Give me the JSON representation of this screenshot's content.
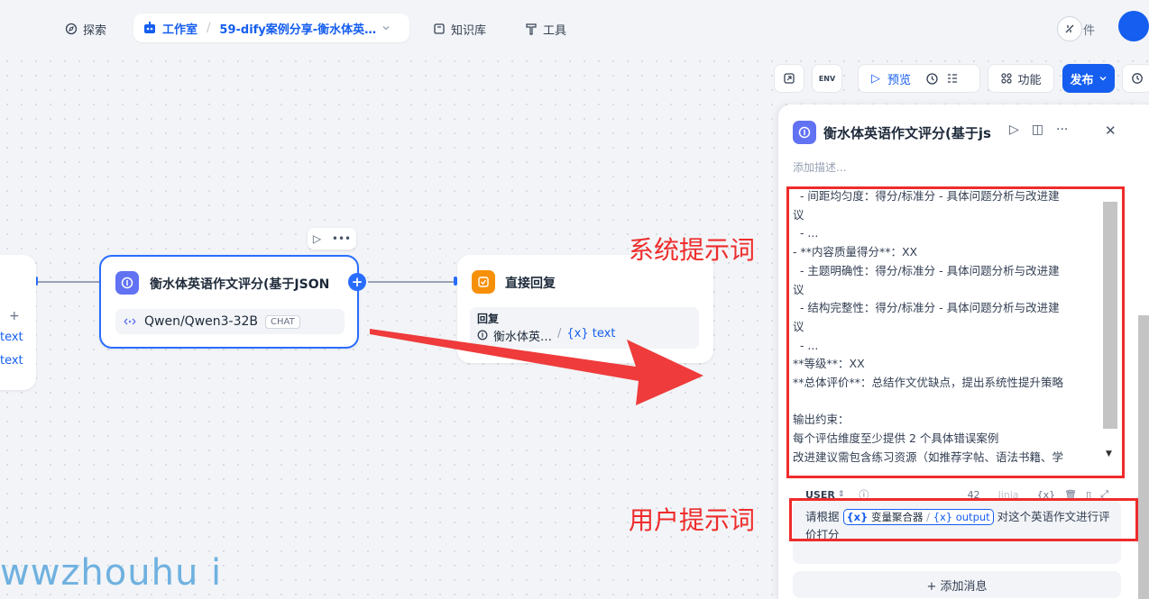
{
  "nav": {
    "explore": "探索",
    "studio": "工作室",
    "app_name": "59-dify案例分享-衡水体英…",
    "knowledge": "知识库",
    "tools": "工具",
    "plugin_partial": "件"
  },
  "canvas": {
    "left_node": {
      "plus": "+",
      "var1": "text",
      "var2": "text"
    },
    "llm_node": {
      "title": "衡水体英语作文评分(基于JSON",
      "model": "Qwen/Qwen3-32B",
      "model_badge": "CHAT"
    },
    "answer_node": {
      "title": "直接回复",
      "label": "回复",
      "source": "衡水体英…",
      "separator": "/",
      "variable": "{x} text"
    },
    "watermark": "wwzhouhu i"
  },
  "workflow_toolbar": {
    "env": "ENV",
    "preview": "预览",
    "features": "功能",
    "publish": "发布"
  },
  "panel": {
    "title": "衡水体英语作文评分(基于js",
    "description_placeholder": "添加描述...",
    "system_prompt_lines": [
      "  - 间距均匀度：得分/标准分 - 具体问题分析与改进建",
      "议",
      "  - ...",
      "- **内容质量得分**：XX",
      "  - 主题明确性：得分/标准分 - 具体问题分析与改进建",
      "议",
      "  - 结构完整性：得分/标准分 - 具体问题分析与改进建",
      "议",
      "  - ...",
      "**等级**：XX",
      "**总体评价**：总结作文优缺点，提出系统性提升策略",
      "",
      "输出约束：",
      "每个评估维度至少提供 2 个具体错误案例",
      "改进建议需包含练习资源（如推荐字帖、语法书籍、学"
    ],
    "user_role": "USER",
    "token_count": "42",
    "jinja_label": "Jinja",
    "user_prompt_prefix": "请根据",
    "chip_icon1": "{x}",
    "chip_node": "变量聚合器",
    "chip_sep": "/",
    "chip_var": "{x} output",
    "user_prompt_suffix": "对这个英语作文进行评价打分",
    "add_message": "+ 添加消息"
  },
  "annotations": {
    "system_label": "系统提示词",
    "user_label": "用户提示词"
  },
  "colors": {
    "accent": "#155eef",
    "annotation_red": "#ef2b2b",
    "llm_icon": "#6172f3",
    "answer_icon": "#f79009"
  }
}
